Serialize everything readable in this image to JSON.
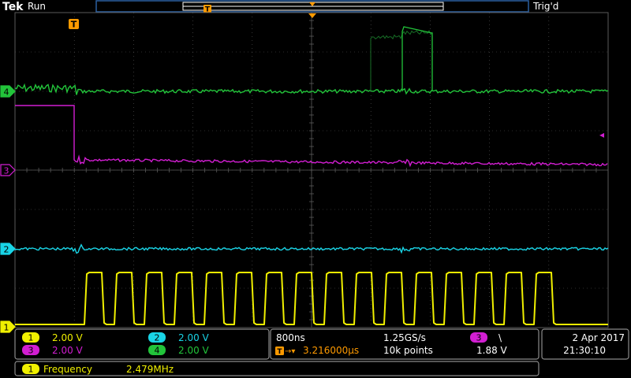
{
  "header": {
    "brand": "Tek",
    "run_state": "Run",
    "trigger_status": "Trig'd",
    "trigger_marker": "T"
  },
  "channels": [
    {
      "id": "1",
      "color": "#f0f000",
      "scale": "2.00 V",
      "marker_label": "1"
    },
    {
      "id": "2",
      "color": "#19d4e6",
      "scale": "2.00 V",
      "marker_label": "2"
    },
    {
      "id": "3",
      "color": "#d21ed2",
      "scale": "2.00 V",
      "marker_label": "3"
    },
    {
      "id": "4",
      "color": "#22c43a",
      "scale": "2.00 V",
      "marker_label": "4"
    }
  ],
  "timebase": {
    "scale": "800ns",
    "sample_rate": "1.25GS/s",
    "trigger_position": "3.216000µs",
    "record_length": "10k points"
  },
  "trigger": {
    "source": "3",
    "slope_symbol": "\\",
    "level": "1.88 V"
  },
  "datetime": {
    "date": "2 Apr 2017",
    "time": "21:30:10"
  },
  "measurement": {
    "channel": "1",
    "label": "Frequency",
    "value": "2.479MHz"
  },
  "trigger_level_marker": "◂",
  "colors": {
    "grid": "#5a5a5a",
    "panel_border": "#8a8a8a",
    "trigger_orange": "#ff9a00",
    "header_bar": "#2a5fa0"
  }
}
